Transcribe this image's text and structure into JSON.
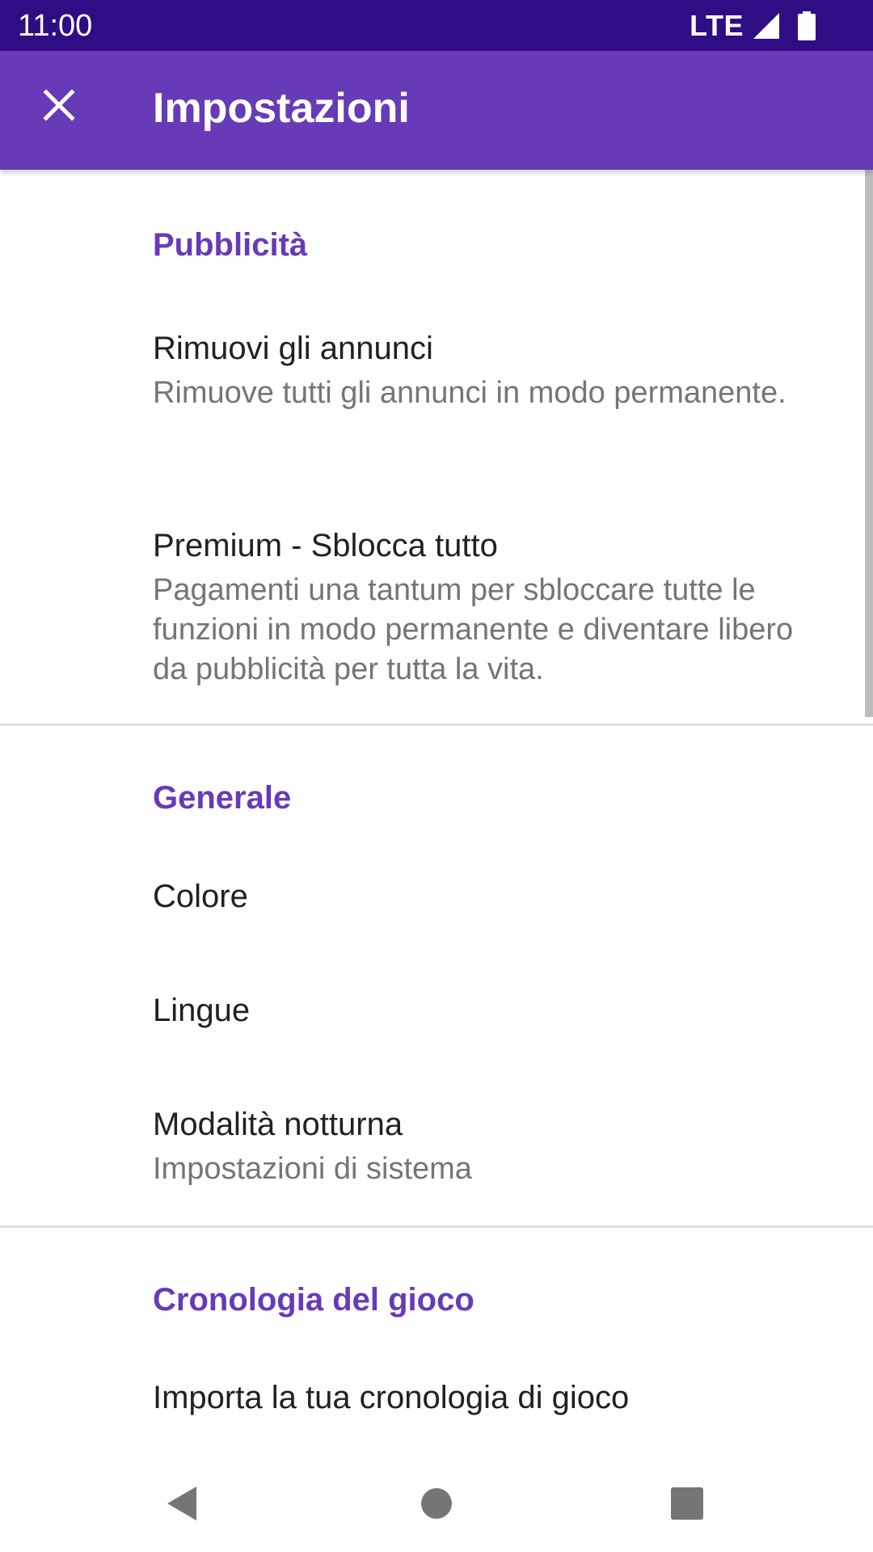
{
  "status_bar": {
    "time": "11:00",
    "network": "LTE"
  },
  "app_bar": {
    "title": "Impostazioni",
    "close_icon": "close-icon"
  },
  "sections": [
    {
      "title": "Pubblicità",
      "items": [
        {
          "title": "Rimuovi gli annunci",
          "summary": "Rimuove tutti gli annunci in modo permanente."
        },
        {
          "title": "Premium - Sblocca tutto",
          "summary": "Pagamenti una tantum per sbloccare tutte le funzioni in modo permanente e diventare libero da pubblicità per tutta la vita."
        }
      ]
    },
    {
      "title": "Generale",
      "items": [
        {
          "title": "Colore"
        },
        {
          "title": "Lingue"
        },
        {
          "title": "Modalità notturna",
          "summary": "Impostazioni di sistema"
        }
      ]
    },
    {
      "title": "Cronologia del gioco",
      "items": [
        {
          "title": "Importa la tua cronologia di gioco"
        }
      ]
    }
  ],
  "nav_bar": {
    "back_icon": "back-triangle-icon",
    "home_icon": "home-circle-icon",
    "recents_icon": "recents-square-icon"
  },
  "colors": {
    "status_bar": "#2e0d85",
    "app_bar": "#673ab7",
    "accent": "#673ab7",
    "title_text": "#212121",
    "summary_text": "#757575"
  }
}
